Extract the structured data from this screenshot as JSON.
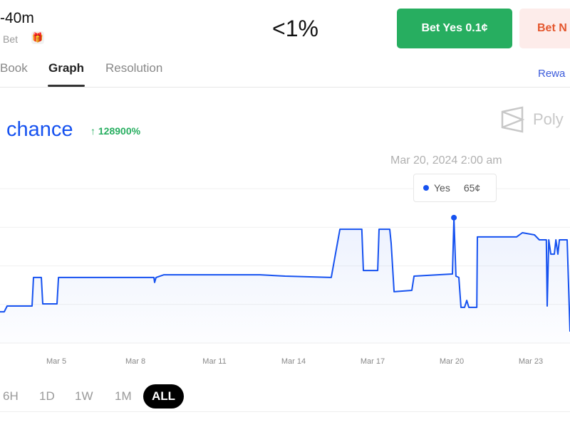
{
  "header": {
    "title": "-40m",
    "subtitle": "Bet",
    "gift_icon": "gift-icon",
    "price_display": "<1%"
  },
  "actions": {
    "bet_yes": "Bet Yes 0.1¢",
    "bet_no": "Bet N"
  },
  "tabs": [
    {
      "label": "Book",
      "active": false
    },
    {
      "label": "Graph",
      "active": true
    },
    {
      "label": "Resolution",
      "active": false
    }
  ],
  "rewards_link": "Rewa",
  "chart_header": {
    "label": "chance",
    "change": "↑ 128900%",
    "brand": "Poly",
    "brand_icon": "polymarket-logo-icon"
  },
  "tooltip": {
    "date": "Mar 20, 2024 2:00 am",
    "series": "Yes",
    "value": "65¢"
  },
  "colors": {
    "accent": "#1652f0",
    "yes": "#27ae60",
    "no": "#e4572e",
    "up": "#27ae60"
  },
  "range_buttons": [
    {
      "label": "6H",
      "active": false
    },
    {
      "label": "1D",
      "active": false
    },
    {
      "label": "1W",
      "active": false
    },
    {
      "label": "1M",
      "active": false
    },
    {
      "label": "ALL",
      "active": true
    }
  ],
  "chart_data": {
    "type": "line",
    "series": [
      {
        "name": "Yes",
        "unit": "¢",
        "points": [
          [
            "2024-03-02T20:45",
            16.2
          ],
          [
            "2024-03-03T00:40",
            16.2
          ],
          [
            "2024-03-03T03:15",
            19.2
          ],
          [
            "2024-03-04T01:57",
            19.2
          ],
          [
            "2024-03-04T03:15",
            34
          ],
          [
            "2024-03-04T10:22",
            34
          ],
          [
            "2024-03-04T11:40",
            20.3
          ],
          [
            "2024-03-05T00:40",
            20.3
          ],
          [
            "2024-03-05T02:00",
            34
          ],
          [
            "2024-03-08T16:50",
            34
          ],
          [
            "2024-03-08T17:30",
            31.4
          ],
          [
            "2024-03-08T18:50",
            34
          ],
          [
            "2024-03-09T02:00",
            35.4
          ],
          [
            "2024-03-12T17:30",
            35.4
          ],
          [
            "2024-03-13T16:20",
            34.7
          ],
          [
            "2024-03-15T10:20",
            34
          ],
          [
            "2024-03-15T18:15",
            59
          ],
          [
            "2024-03-16T14:10",
            59
          ],
          [
            "2024-03-16T15:35",
            37.6
          ],
          [
            "2024-03-17T04:35",
            37.6
          ],
          [
            "2024-03-17T05:50",
            59
          ],
          [
            "2024-03-17T15:35",
            59
          ],
          [
            "2024-03-17T16:50",
            51.7
          ],
          [
            "2024-03-17T19:30",
            26.6
          ],
          [
            "2024-03-18T11:40",
            27.3
          ],
          [
            "2024-03-18T13:40",
            34.7
          ],
          [
            "2024-03-20T00:40",
            35.8
          ],
          [
            "2024-03-20T02:00",
            65
          ],
          [
            "2024-03-20T03:50",
            34.7
          ],
          [
            "2024-03-20T06:30",
            34
          ],
          [
            "2024-03-20T08:25",
            18.5
          ],
          [
            "2024-03-20T11:40",
            18.5
          ],
          [
            "2024-03-20T13:40",
            22.1
          ],
          [
            "2024-03-20T15:35",
            18.5
          ],
          [
            "2024-03-20T22:50",
            18.5
          ],
          [
            "2024-03-20T23:20",
            55
          ],
          [
            "2024-03-22T11:00",
            55
          ],
          [
            "2024-03-22T16:20",
            57.2
          ],
          [
            "2024-03-23T03:20",
            56.1
          ],
          [
            "2024-03-23T07:45",
            53.5
          ],
          [
            "2024-03-23T14:10",
            53.5
          ],
          [
            "2024-03-23T14:55",
            19.2
          ],
          [
            "2024-03-23T16:20",
            53.5
          ],
          [
            "2024-03-23T18:15",
            46.1
          ],
          [
            "2024-03-23T21:25",
            46.1
          ],
          [
            "2024-03-23T22:50",
            53.5
          ],
          [
            "2024-03-24T00:40",
            46.1
          ],
          [
            "2024-03-24T02:00",
            53.5
          ],
          [
            "2024-03-24T09:05",
            53.5
          ],
          [
            "2024-03-24T11:40",
            5.9
          ]
        ]
      }
    ],
    "highlight": {
      "x": "2024-03-20T02:00",
      "y": 65
    },
    "x_ticks": [
      "Mar 5",
      "Mar 8",
      "Mar 11",
      "Mar 14",
      "Mar 17",
      "Mar 20",
      "Mar 23"
    ],
    "y_range": [
      0,
      100
    ],
    "y_gridlines": [
      20,
      40,
      60,
      80
    ],
    "grid": true
  }
}
